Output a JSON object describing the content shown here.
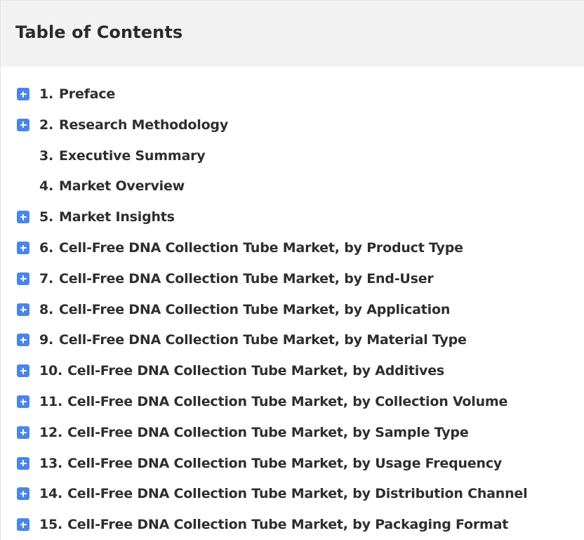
{
  "toc": {
    "title": "Table of Contents",
    "items": [
      {
        "num": "1.",
        "label": "Preface",
        "expandable": true
      },
      {
        "num": "2.",
        "label": "Research Methodology",
        "expandable": true
      },
      {
        "num": "3.",
        "label": "Executive Summary",
        "expandable": false
      },
      {
        "num": "4.",
        "label": "Market Overview",
        "expandable": false
      },
      {
        "num": "5.",
        "label": "Market Insights",
        "expandable": true
      },
      {
        "num": "6.",
        "label": "Cell-Free DNA Collection Tube Market, by Product Type",
        "expandable": true
      },
      {
        "num": "7.",
        "label": "Cell-Free DNA Collection Tube Market, by End-User",
        "expandable": true
      },
      {
        "num": "8.",
        "label": "Cell-Free DNA Collection Tube Market, by Application",
        "expandable": true
      },
      {
        "num": "9.",
        "label": "Cell-Free DNA Collection Tube Market, by Material Type",
        "expandable": true
      },
      {
        "num": "10.",
        "label": "Cell-Free DNA Collection Tube Market, by Additives",
        "expandable": true
      },
      {
        "num": "11.",
        "label": "Cell-Free DNA Collection Tube Market, by Collection Volume",
        "expandable": true
      },
      {
        "num": "12.",
        "label": "Cell-Free DNA Collection Tube Market, by Sample Type",
        "expandable": true
      },
      {
        "num": "13.",
        "label": "Cell-Free DNA Collection Tube Market, by Usage Frequency",
        "expandable": true
      },
      {
        "num": "14.",
        "label": "Cell-Free DNA Collection Tube Market, by Distribution Channel",
        "expandable": true
      },
      {
        "num": "15.",
        "label": "Cell-Free DNA Collection Tube Market, by Packaging Format",
        "expandable": true
      }
    ]
  },
  "colors": {
    "accent": "#4a86e8",
    "header_bg": "#f2f2f2",
    "text": "#2e2e2e"
  },
  "icons": {
    "expand": "plus-square-icon"
  }
}
